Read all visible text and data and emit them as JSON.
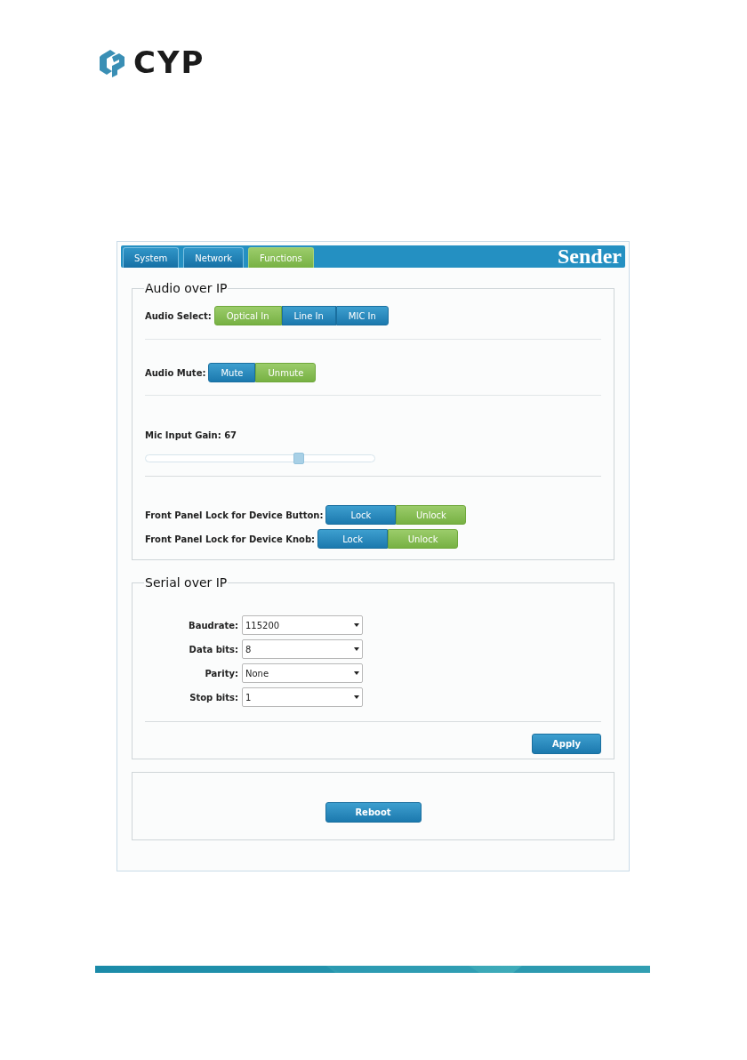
{
  "logo": {
    "text": "CYP"
  },
  "tabs": [
    {
      "label": "System",
      "selected": false
    },
    {
      "label": "Network",
      "selected": false
    },
    {
      "label": "Functions",
      "selected": true
    }
  ],
  "header_title": "Sender",
  "audio_over_ip": {
    "title": "Audio over IP",
    "audio_select": {
      "label": "Audio Select:",
      "options": [
        {
          "label": "Optical In",
          "selected": true
        },
        {
          "label": "Line In",
          "selected": false
        },
        {
          "label": "MIC In",
          "selected": false
        }
      ]
    },
    "audio_mute": {
      "label": "Audio Mute:",
      "options": [
        {
          "label": "Mute",
          "selected": false
        },
        {
          "label": "Unmute",
          "selected": true
        }
      ]
    },
    "mic_input_gain": {
      "label": "Mic Input Gain: 67",
      "level": 0.67
    },
    "front_panel_locks": [
      {
        "label": "Front Panel Lock for Device Button:",
        "options": [
          {
            "label": "Lock",
            "selected": false
          },
          {
            "label": "Unlock",
            "selected": true
          }
        ]
      },
      {
        "label": "Front Panel Lock for Device Knob:",
        "options": [
          {
            "label": "Lock",
            "selected": false
          },
          {
            "label": "Unlock",
            "selected": true
          }
        ]
      }
    ]
  },
  "serial_over_ip": {
    "title": "Serial over IP",
    "fields": [
      {
        "label": "Baudrate:",
        "value": "115200"
      },
      {
        "label": "Data bits:",
        "value": "8"
      },
      {
        "label": "Parity:",
        "value": "None"
      },
      {
        "label": "Stop bits:",
        "value": "1"
      }
    ],
    "apply_button": "Apply"
  },
  "reboot_button": "Reboot"
}
